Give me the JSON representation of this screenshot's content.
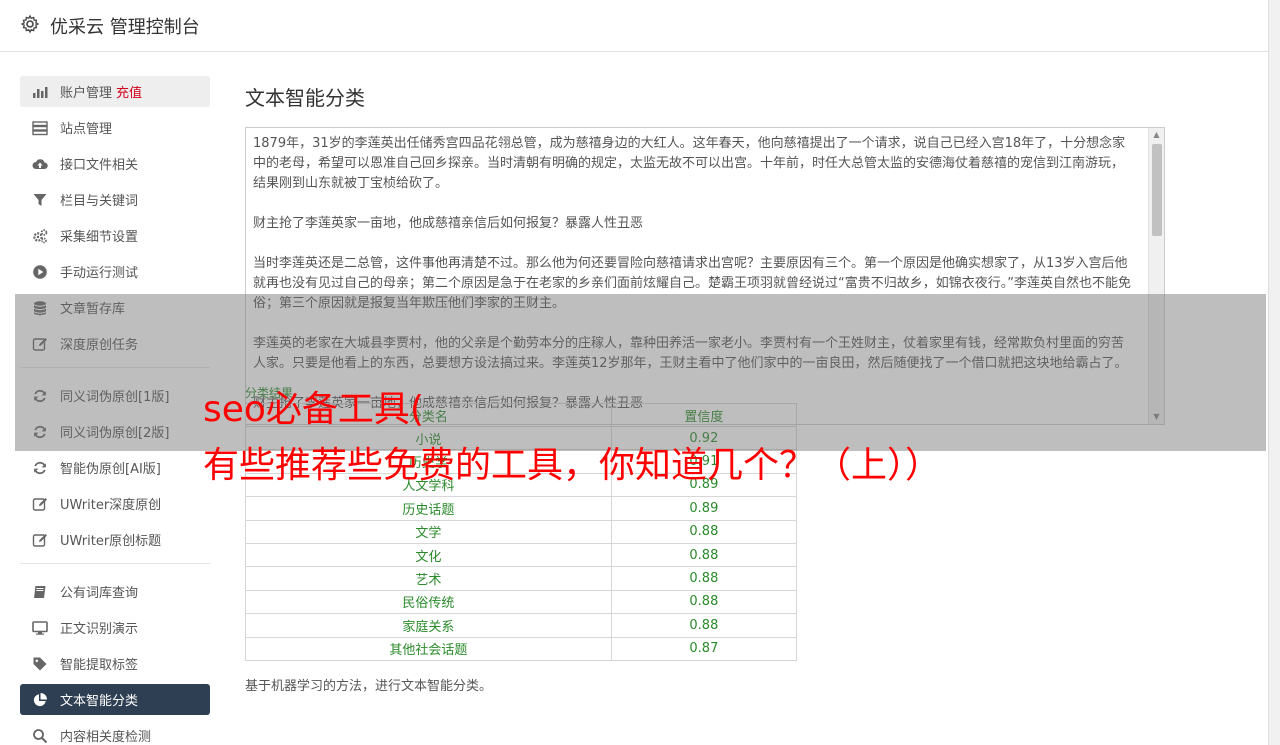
{
  "header": {
    "title": "优采云 管理控制台",
    "icon": "gear-icon"
  },
  "sidebar": {
    "groups": [
      [
        {
          "label": "账户管理",
          "extra": "充值",
          "icon": "bar-chart-icon"
        },
        {
          "label": "站点管理",
          "icon": "server-icon"
        },
        {
          "label": "接口文件相关",
          "icon": "cloud-upload-icon"
        },
        {
          "label": "栏目与关键词",
          "icon": "filter-icon"
        },
        {
          "label": "采集细节设置",
          "icon": "gears-icon"
        },
        {
          "label": "手动运行测试",
          "icon": "play-circle-icon"
        },
        {
          "label": "文章暂存库",
          "icon": "database-icon"
        },
        {
          "label": "深度原创任务",
          "icon": "edit-icon"
        }
      ],
      [
        {
          "label": "同义词伪原创[1版]",
          "icon": "refresh-icon"
        },
        {
          "label": "同义词伪原创[2版]",
          "icon": "refresh-icon"
        },
        {
          "label": "智能伪原创[AI版]",
          "icon": "refresh-icon"
        },
        {
          "label": "UWriter深度原创",
          "icon": "edit-icon"
        },
        {
          "label": "UWriter原创标题",
          "icon": "edit-icon"
        }
      ],
      [
        {
          "label": "公有词库查询",
          "icon": "book-icon"
        },
        {
          "label": "正文识别演示",
          "icon": "desktop-icon"
        },
        {
          "label": "智能提取标签",
          "icon": "tag-icon"
        },
        {
          "label": "文本智能分类",
          "icon": "pie-chart-icon",
          "active": true
        },
        {
          "label": "内容相关度检测",
          "icon": "search-icon"
        }
      ]
    ]
  },
  "main": {
    "title": "文本智能分类",
    "text": "1879年，31岁的李莲英出任储秀宫四品花翎总管，成为慈禧身边的大红人。这年春天，他向慈禧提出了一个请求，说自己已经入宫18年了，十分想念家中的老母，希望可以恩准自己回乡探亲。当时清朝有明确的规定，太监无故不可以出宫。十年前，时任大总管太监的安德海仗着慈禧的宠信到江南游玩，结果刚到山东就被丁宝桢给砍了。\n\n财主抢了李莲英家一亩地，他成慈禧亲信后如何报复？暴露人性丑恶\n\n当时李莲英还是二总管，这件事他再清楚不过。那么他为何还要冒险向慈禧请求出宫呢？主要原因有三个。第一个原因是他确实想家了，从13岁入宫后他就再也没有见过自己的母亲；第二个原因是急于在老家的乡亲们面前炫耀自己。楚霸王项羽就曾经说过“富贵不归故乡，如锦衣夜行。”李莲英自然也不能免俗；第三个原因就是报复当年欺压他们李家的王财主。\n\n李莲英的老家在大城县李贾村，他的父亲是个勤劳本分的庄稼人，靠种田养活一家老小。李贾村有一个王姓财主，仗着家里有钱，经常欺负村里面的穷苦人家。只要是他看上的东西，总要想方设法搞过来。李莲英12岁那年，王财主看中了他们家中的一亩良田，然后随便找了一个借口就把这块地给霸占了。\n\n财主抢了李莲英家一亩地，他成慈禧亲信后如何报复？暴露人性丑恶",
    "result_label": "分类结果",
    "table": {
      "headers": [
        "分类名",
        "置信度"
      ],
      "rows": [
        [
          "小说",
          "0.92"
        ],
        [
          "历史学",
          "0.91"
        ],
        [
          "人文学科",
          "0.89"
        ],
        [
          "历史话题",
          "0.89"
        ],
        [
          "文学",
          "0.88"
        ],
        [
          "文化",
          "0.88"
        ],
        [
          "艺术",
          "0.88"
        ],
        [
          "民俗传统",
          "0.88"
        ],
        [
          "家庭关系",
          "0.88"
        ],
        [
          "其他社会话题",
          "0.87"
        ]
      ]
    },
    "description": "基于机器学习的方法，进行文本智能分类。"
  },
  "overlay": {
    "title": "seo必备工具(",
    "subtitle": "有些推荐些免费的工具，你知道几个？（上））"
  },
  "colors": {
    "active_nav": "#2f3f53",
    "accent_red": "#d0021b",
    "result_green": "#2a8a2a",
    "overlay_text": "#ff0000"
  }
}
